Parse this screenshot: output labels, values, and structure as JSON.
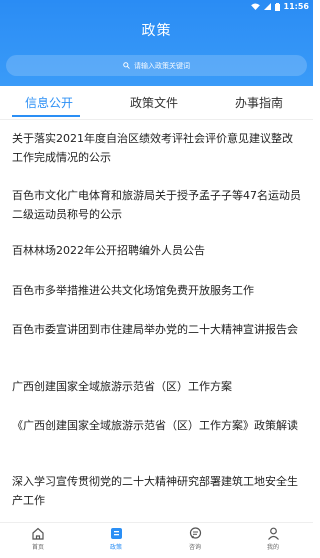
{
  "status": {
    "time": "11:56"
  },
  "header": {
    "title": "政策"
  },
  "search": {
    "placeholder": "请输入政策关键词"
  },
  "tabs": [
    {
      "label": "信息公开",
      "active": true
    },
    {
      "label": "政策文件",
      "active": false
    },
    {
      "label": "办事指南",
      "active": false
    }
  ],
  "items": [
    "关于落实2021年度自治区绩效考评社会评价意见建议整改工作完成情况的公示",
    "百色市文化广电体育和旅游局关于授予孟子子等47名运动员二级运动员称号的公示",
    "百林林场2022年公开招聘编外人员公告",
    "百色市多举措推进公共文化场馆免费开放服务工作",
    "百色市委宣讲团到市住建局举办党的二十大精神宣讲报告会",
    "广西创建国家全域旅游示范省（区）工作方案",
    "《广西创建国家全域旅游示范省（区）工作方案》政策解读",
    "深入学习宣传贯彻党的二十大精神研究部署建筑工地安全生产工作"
  ],
  "tabbar": [
    {
      "label": "首页",
      "icon": "home-icon",
      "active": false
    },
    {
      "label": "政策",
      "icon": "policy-icon",
      "active": true
    },
    {
      "label": "咨询",
      "icon": "chat-icon",
      "active": false
    },
    {
      "label": "我的",
      "icon": "user-icon",
      "active": false
    }
  ],
  "colors": {
    "accent": "#2b8ff5",
    "header": "#3a9bf8"
  }
}
